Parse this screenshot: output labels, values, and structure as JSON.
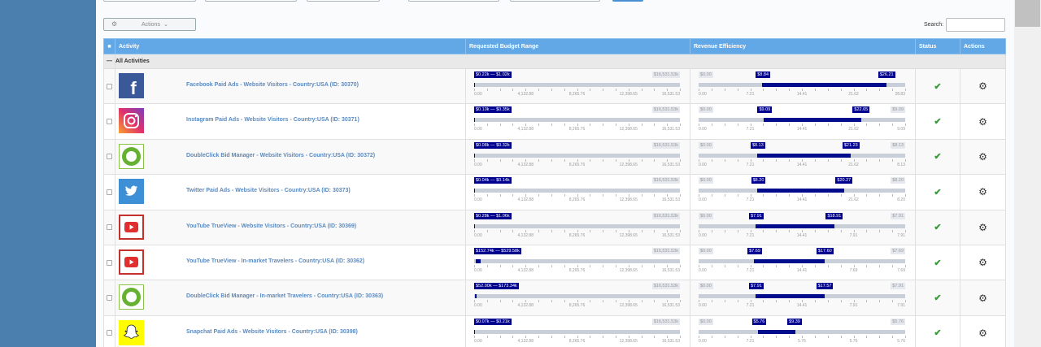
{
  "toolbar": {
    "actions_label": "Actions",
    "search_label": "Search:",
    "search_value": ""
  },
  "table": {
    "headers": [
      "Activity",
      "Requested Budget Range",
      "Revenue Efficiency",
      "Status",
      "Actions"
    ],
    "group_label": "All Activities",
    "rows": [
      {
        "name": "Facebook Paid Ads - Website Visitors - Country:USA (ID: 30370)",
        "icon": "facebook-icon",
        "budget": {
          "label": "$0.22k — $1.02k",
          "max_label": "$16,531.53k",
          "lo": 0.22,
          "hi": 1.02,
          "max": 16531.53,
          "ticks": [
            "0.00",
            "4,132.88",
            "8,265.76",
            "12,398.65",
            "16,531.53"
          ]
        },
        "eff": {
          "min_label": "$0.00",
          "lo_label": "$8.84",
          "hi_label": "$26.21",
          "max_label": "",
          "lo": 8.84,
          "hi": 26.21,
          "max": 28.83,
          "ticks": [
            "0.00",
            "7.21",
            "14.41",
            "21.62",
            "28.83"
          ]
        }
      },
      {
        "name": "Instagram Paid Ads - Website Visitors - Country:USA (ID: 30371)",
        "icon": "instagram-icon",
        "budget": {
          "label": "$0.10k — $0.35k",
          "max_label": "$16,531.53k",
          "lo": 0.1,
          "hi": 0.35,
          "max": 16531.53,
          "ticks": [
            "0.00",
            "4,132.88",
            "8,265.76",
            "12,398.65",
            "16,531.53"
          ]
        },
        "eff": {
          "min_label": "$0.00",
          "lo_label": "$9.09",
          "hi_label": "$22.65",
          "max_label": "$9.09",
          "lo": 9.09,
          "hi": 22.65,
          "max": 28.83,
          "ticks": [
            "0.00",
            "7.21",
            "14.41",
            "21.62",
            "9.09"
          ]
        }
      },
      {
        "name": "DoubleClick Bid Manager - Website Visitors - Country:USA (ID: 30372)",
        "icon": "doubleclick-icon",
        "budget": {
          "label": "$0.08k — $0.32k",
          "max_label": "$16,531.53k",
          "lo": 0.08,
          "hi": 0.32,
          "max": 16531.53,
          "ticks": [
            "0.00",
            "4,132.88",
            "8,265.76",
            "12,398.65",
            "16,531.53"
          ]
        },
        "eff": {
          "min_label": "$0.00",
          "lo_label": "$8.13",
          "hi_label": "$21.23",
          "max_label": "$8.13",
          "lo": 8.13,
          "hi": 21.23,
          "max": 28.83,
          "ticks": [
            "0.00",
            "7.21",
            "14.41",
            "21.62",
            "8.13"
          ]
        }
      },
      {
        "name": "Twitter Paid Ads - Website Visitors - Country:USA (ID: 30373)",
        "icon": "twitter-icon",
        "budget": {
          "label": "$0.04k — $0.14k",
          "max_label": "$16,531.53k",
          "lo": 0.04,
          "hi": 0.14,
          "max": 16531.53,
          "ticks": [
            "0.00",
            "4,132.88",
            "8,265.76",
            "12,398.65",
            "16,531.53"
          ]
        },
        "eff": {
          "min_label": "$0.00",
          "lo_label": "$8.20",
          "hi_label": "$20.27",
          "max_label": "$8.20",
          "lo": 8.2,
          "hi": 20.27,
          "max": 28.83,
          "ticks": [
            "0.00",
            "7.21",
            "14.41",
            "21.62",
            "8.20"
          ]
        }
      },
      {
        "name": "YouTube TrueView - Website Visitors - Country:USA (ID: 30369)",
        "icon": "youtube-icon",
        "budget": {
          "label": "$0.28k — $1.06k",
          "max_label": "$16,531.53k",
          "lo": 0.28,
          "hi": 1.06,
          "max": 16531.53,
          "ticks": [
            "0.00",
            "4,132.88",
            "8,265.76",
            "12,398.65",
            "16,531.53"
          ]
        },
        "eff": {
          "min_label": "$0.00",
          "lo_label": "$7.91",
          "hi_label": "$18.91",
          "max_label": "$7.91",
          "lo": 7.91,
          "hi": 18.91,
          "max": 28.83,
          "ticks": [
            "0.00",
            "7.21",
            "14.41",
            "7.91",
            "7.91"
          ]
        }
      },
      {
        "name": "YouTube TrueView - In-market Travelers - Country:USA (ID: 30362)",
        "icon": "youtube-icon",
        "budget": {
          "label": "$152.74k — $529.58k",
          "max_label": "$16,531.53k",
          "lo": 152.74,
          "hi": 529.58,
          "max": 16531.53,
          "ticks": [
            "0.00",
            "4,132.88",
            "8,265.76",
            "12,398.65",
            "16,531.53"
          ]
        },
        "eff": {
          "min_label": "$0.00",
          "lo_label": "$7.69",
          "hi_label": "$17.60",
          "max_label": "$7.69",
          "lo": 7.69,
          "hi": 17.6,
          "max": 28.83,
          "ticks": [
            "0.00",
            "7.21",
            "14.41",
            "7.69",
            "7.69"
          ]
        }
      },
      {
        "name": "DoubleClick Bid Manager - In-market Travelers - Country:USA (ID: 30363)",
        "icon": "doubleclick-icon",
        "budget": {
          "label": "$52.00k — $173.34k",
          "max_label": "$16,531.53k",
          "lo": 52.0,
          "hi": 173.34,
          "max": 16531.53,
          "ticks": [
            "0.00",
            "4,132.88",
            "8,265.76",
            "12,398.65",
            "16,531.53"
          ]
        },
        "eff": {
          "min_label": "$0.00",
          "lo_label": "$7.91",
          "hi_label": "$17.57",
          "max_label": "$7.91",
          "lo": 7.91,
          "hi": 17.57,
          "max": 28.83,
          "ticks": [
            "0.00",
            "7.21",
            "14.41",
            "7.91",
            "7.91"
          ]
        }
      },
      {
        "name": "Snapchat Paid Ads - Website Visitors - Country:USA (ID: 30398)",
        "icon": "snapchat-icon",
        "budget": {
          "label": "$0.07k — $0.21k",
          "max_label": "$16,531.53k",
          "lo": 0.07,
          "hi": 0.21,
          "max": 16531.53,
          "ticks": [
            "0.00",
            "4,132.88",
            "8,265.76",
            "12,398.65",
            "16,531.53"
          ]
        },
        "eff": {
          "min_label": "$0.00",
          "lo_label": "$5.76",
          "hi_label": "$9.39",
          "max_label": "$5.76",
          "lo": 5.76,
          "hi": 9.39,
          "max": 20.0,
          "ticks": [
            "0.00",
            "7.21",
            "5.76",
            "5.76",
            "5.76"
          ]
        }
      }
    ]
  },
  "colors": {
    "header": "#62a7e6",
    "range_fill": "#000c8c",
    "status_ok": "#3a9a3a",
    "sidebar": "#4a7fae"
  }
}
